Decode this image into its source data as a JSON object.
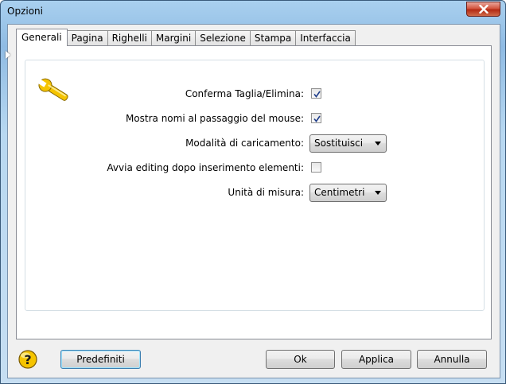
{
  "window": {
    "title": "Opzioni"
  },
  "tabs": [
    {
      "label": "Generali",
      "active": true
    },
    {
      "label": "Pagina",
      "active": false
    },
    {
      "label": "Righelli",
      "active": false
    },
    {
      "label": "Margini",
      "active": false
    },
    {
      "label": "Selezione",
      "active": false
    },
    {
      "label": "Stampa",
      "active": false
    },
    {
      "label": "Interfaccia",
      "active": false
    }
  ],
  "options": {
    "confirm_cut_delete": {
      "label": "Conferma Taglia/Elimina:",
      "checked": true
    },
    "show_names_hover": {
      "label": "Mostra nomi al passaggio del mouse:",
      "checked": true
    },
    "load_mode": {
      "label": "Modalità di caricamento:",
      "value": "Sostituisci"
    },
    "edit_after_insert": {
      "label": "Avvia editing dopo inserimento elementi:",
      "checked": false
    },
    "unit": {
      "label": "Unità di misura:",
      "value": "Centimetri"
    }
  },
  "buttons": {
    "defaults": "Predefiniti",
    "ok": "Ok",
    "apply": "Applica",
    "cancel": "Annulla"
  },
  "icons": {
    "settings": "wrench-icon",
    "help": "help-icon",
    "close": "close-icon"
  },
  "colors": {
    "accent": "#f5c400",
    "close_button": "#c7462f"
  }
}
